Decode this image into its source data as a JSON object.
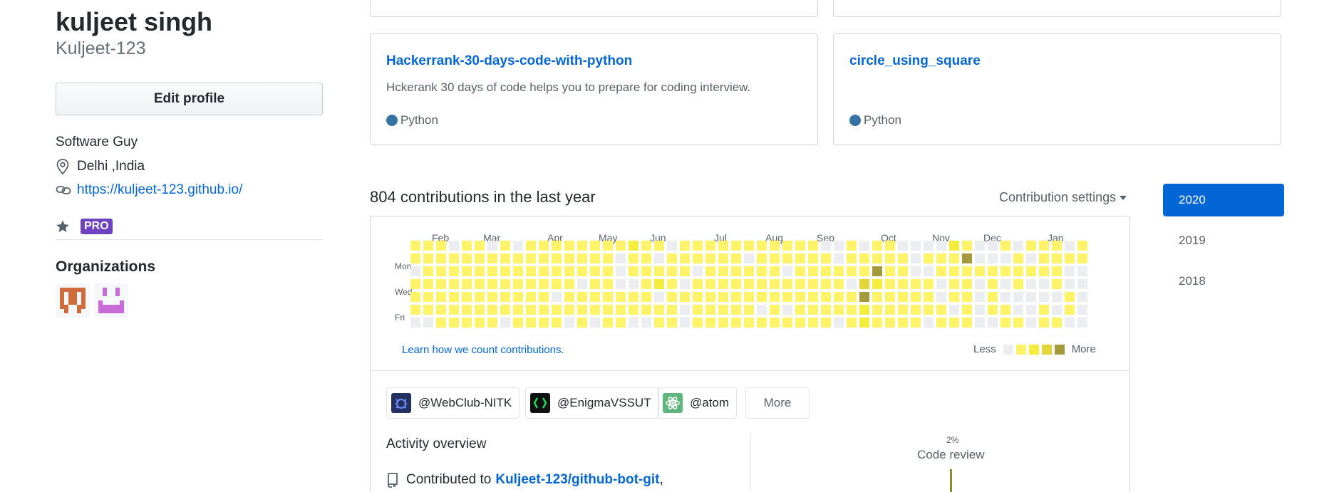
{
  "profile": {
    "full_name": "kuljeet singh",
    "username": "Kuljeet-123",
    "edit_label": "Edit profile",
    "bio": "Software Guy",
    "location": "Delhi ,India",
    "website": "https://kuljeet-123.github.io/",
    "badge": "PRO",
    "organizations_title": "Organizations"
  },
  "pinned": [
    {
      "title": "Hackerrank-30-days-code-with-python",
      "description": "Hckerank 30 days of code helps you to prepare for coding interview.",
      "language": "Python",
      "language_color": "#3572A5"
    },
    {
      "title": "circle_using_square",
      "description": "",
      "language": "Python",
      "language_color": "#3572A5"
    }
  ],
  "contributions": {
    "heading": "804 contributions in the last year",
    "settings_label": "Contribution settings",
    "months": [
      "Feb",
      "Mar",
      "Apr",
      "May",
      "Jun",
      "Jul",
      "Aug",
      "Sep",
      "Oct",
      "Nov",
      "Dec",
      "Jan"
    ],
    "weekday_labels": [
      "Mon",
      "Wed",
      "Fri"
    ],
    "learn_link": "Learn how we count contributions.",
    "legend_less": "Less",
    "legend_more": "More",
    "level_colors": [
      "#ebedf0",
      "#fff36a",
      "#f5ed3c",
      "#e3d63a",
      "#a29a3d"
    ]
  },
  "org_filters": [
    "@WebClub-NITK",
    "@EnigmaVSSUT",
    "@atom"
  ],
  "more_label": "More",
  "activity": {
    "title": "Activity overview",
    "contributed_prefix": "Contributed to",
    "repo": "Kuljeet-123/github-bot-git",
    "repo_suffix": ",",
    "code_review_pct": "2%",
    "code_review_label": "Code review"
  },
  "years": [
    "2020",
    "2019",
    "2018"
  ],
  "active_year": "2020"
}
